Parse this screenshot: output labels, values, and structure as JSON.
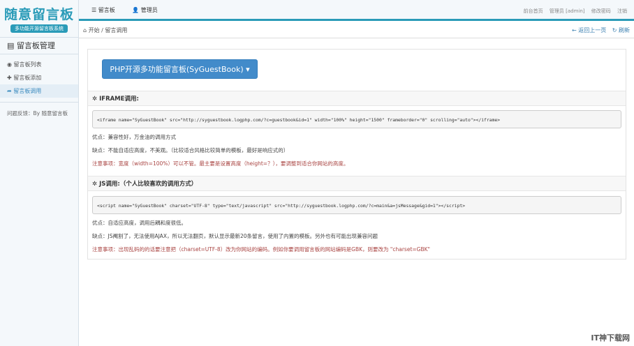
{
  "logo": {
    "title": "随意留言板",
    "subtitle": "多功能开源留言板系统"
  },
  "sidebar": {
    "heading": "留言板管理",
    "items": [
      {
        "label": "留言板列表"
      },
      {
        "label": "留言板添加"
      },
      {
        "label": "留言板调用"
      }
    ],
    "footer": "问题反馈：By 随意留言板"
  },
  "topnav": {
    "items": [
      {
        "label": "留言板"
      },
      {
        "label": "管理员"
      }
    ],
    "links": [
      "前台首页",
      "管理员 [admin]",
      "修改密码",
      "注销"
    ]
  },
  "breadcrumb": {
    "home": "开始",
    "sep": "/",
    "current": "留言调用",
    "back": "返回上一页",
    "refresh": "刷新"
  },
  "main": {
    "button": "PHP开源多功能留言板(SyGuestBook) ▾",
    "iframe": {
      "title": "IFRAME调用:",
      "code": "<iframe name=\"SyGuestBook\" src=\"http://syguestbook.logphp.com/?c=guestbook&id=1\" width=\"100%\" height=\"1500\" frameborder=\"0\" scrolling=\"auto\"></iframe>",
      "pro": "优点：兼容性好，万金油的调用方式",
      "con": "缺点：不能自适应高度，不美观。（比较适合风格比较简单的模板，最好是响应式的）",
      "note": "注意事项：宽度（width=100%）可以不管。最主要是设置高度（height=？），要调整到适合你网站的高度。"
    },
    "js": {
      "title": "JS调用:（个人比较喜欢的调用方式）",
      "code": "<script name=\"SyGuestBook\" charset=\"UTF-8\" type=\"text/javascript\" src=\"http://syguestbook.logphp.com/?c=main&a=jsMessage&gid=1\"></script>",
      "pro": "优点：自适应高度，调用后耦和度很低。",
      "con": "缺点：JS阉割了，无法使用AJAX，所以无法翻页，默认显示最新20条留言，使用了内置的模板。另外也有可能出现兼容问题",
      "note": "注意事项：出现乱码的的话要注意把（charset=UTF-8）改为你网站的编码。例如你要调用留言板的网站编码是GBK，则要改为 \"charset=GBK\""
    }
  },
  "watermark": "IT神下载网"
}
